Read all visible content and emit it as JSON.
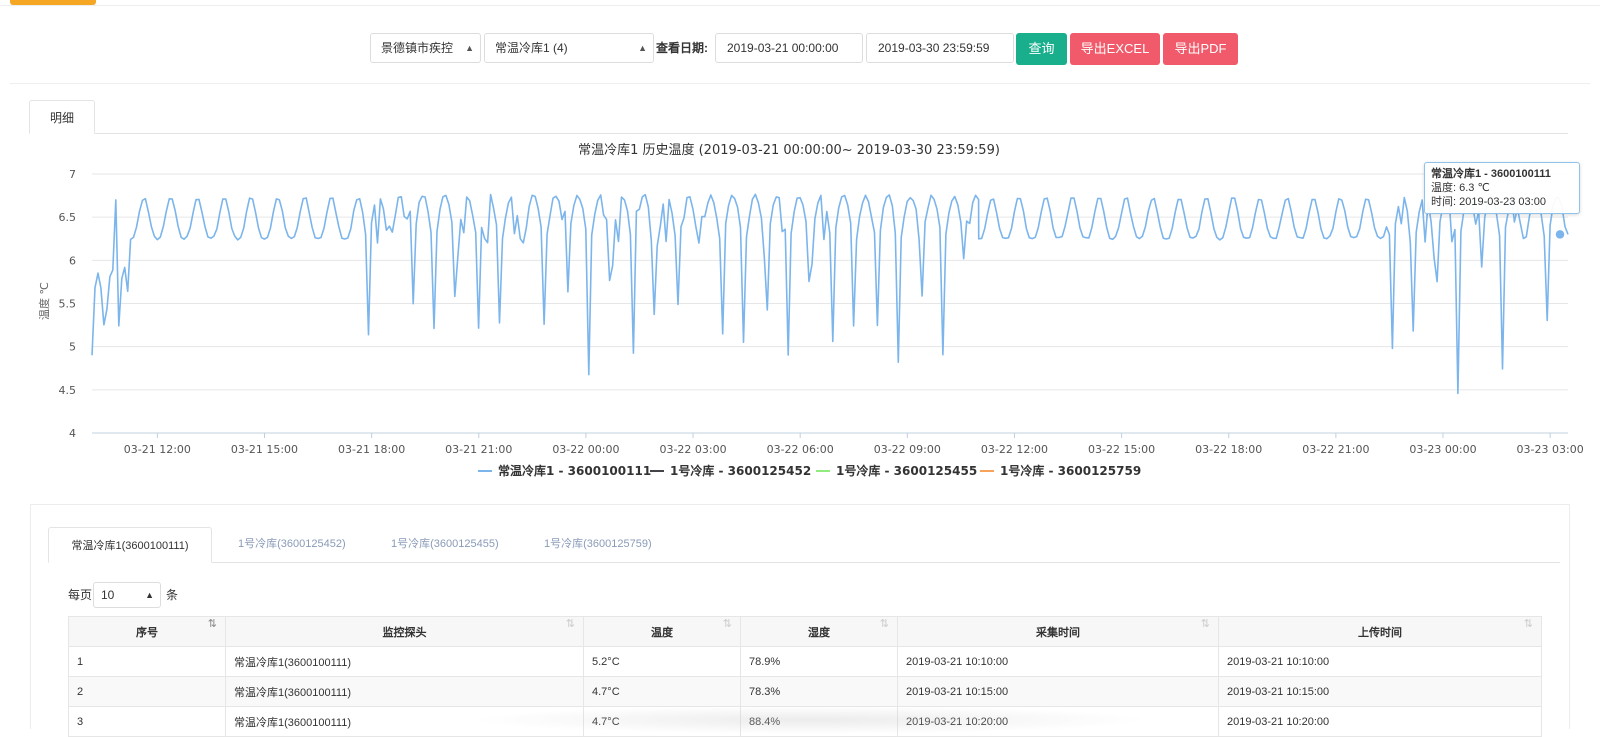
{
  "toolbar": {
    "org_select": "景德镇市疾控",
    "device_select": "常温冷库1 (4)",
    "date_label": "查看日期:",
    "start_date": "2019-03-21 00:00:00",
    "end_date": "2019-03-30 23:59:59",
    "query_button": "查询",
    "excel_button": "导出EXCEL",
    "pdf_button": "导出PDF"
  },
  "detail_tab": "明细",
  "colors": {
    "accent": "#f5a623",
    "green": "#1aaf8c",
    "red": "#f05a6a",
    "line": "#7cb5ec"
  },
  "tooltip": {
    "title": "常温冷库1 - 3600100111",
    "temp": "温度: 6.3 ℃",
    "time": "时间: 2019-03-23 03:00"
  },
  "chart_data": {
    "type": "line",
    "title": "常温冷库1 历史温度 (2019-03-21 00:00:00~ 2019-03-30 23:59:59)",
    "ylabel": "温度 ℃",
    "ylim": [
      4,
      7
    ],
    "yticks": [
      "4",
      "4.5",
      "5",
      "5.5",
      "6",
      "6.5",
      "7"
    ],
    "xticks": [
      "03-21 12:00",
      "03-21 15:00",
      "03-21 18:00",
      "03-21 21:00",
      "03-22 00:00",
      "03-22 03:00",
      "03-22 06:00",
      "03-22 09:00",
      "03-22 12:00",
      "03-22 15:00",
      "03-22 18:00",
      "03-22 21:00",
      "03-23 00:00",
      "03-23 03:00"
    ],
    "x_start_hours": 10.17,
    "x_end_hours": 51.5,
    "legend": [
      "常温冷库1 - 3600100111",
      "1号冷库 - 3600125452",
      "1号冷库 - 3600125455",
      "1号冷库 - 3600125759"
    ],
    "legend_colors": [
      "#7cb5ec",
      "#434348",
      "#90ed7d",
      "#f7a35c"
    ],
    "series": [
      {
        "name": "常温冷库1 - 3600100111",
        "sample_interval_minutes": 5,
        "segments": [
          {
            "from_hour": 10.17,
            "to_hour": 11.25,
            "pattern": "unstable-low",
            "min": 4.65,
            "max": 6.7
          },
          {
            "from_hour": 11.25,
            "to_hour": 17.83,
            "pattern": "normal",
            "min": 6.22,
            "max": 6.75
          },
          {
            "from_hour": 17.83,
            "to_hour": 35.0,
            "pattern": "dips",
            "min": 4.55,
            "max": 6.82
          },
          {
            "from_hour": 35.0,
            "to_hour": 46.5,
            "pattern": "normal",
            "min": 6.22,
            "max": 6.75
          },
          {
            "from_hour": 46.5,
            "to_hour": 51.5,
            "pattern": "dips",
            "min": 4.45,
            "max": 6.8
          }
        ],
        "last_point": {
          "x": "2019-03-23 03:00",
          "y": 6.3
        }
      }
    ]
  },
  "detail_tabs": [
    "常温冷库1(3600100111)",
    "1号冷库(3600125452)",
    "1号冷库(3600125455)",
    "1号冷库(3600125759)"
  ],
  "pager": {
    "prefix": "每页",
    "value": "10",
    "suffix": "条"
  },
  "table": {
    "headers": [
      "序号",
      "监控探头",
      "温度",
      "湿度",
      "采集时间",
      "上传时间"
    ],
    "rows": [
      [
        "1",
        "常温冷库1(3600100111)",
        "5.2°C",
        "78.9%",
        "2019-03-21 10:10:00",
        "2019-03-21 10:10:00"
      ],
      [
        "2",
        "常温冷库1(3600100111)",
        "4.7°C",
        "78.3%",
        "2019-03-21 10:15:00",
        "2019-03-21 10:15:00"
      ],
      [
        "3",
        "常温冷库1(3600100111)",
        "4.7°C",
        "88.4%",
        "2019-03-21 10:20:00",
        "2019-03-21 10:20:00"
      ]
    ]
  }
}
